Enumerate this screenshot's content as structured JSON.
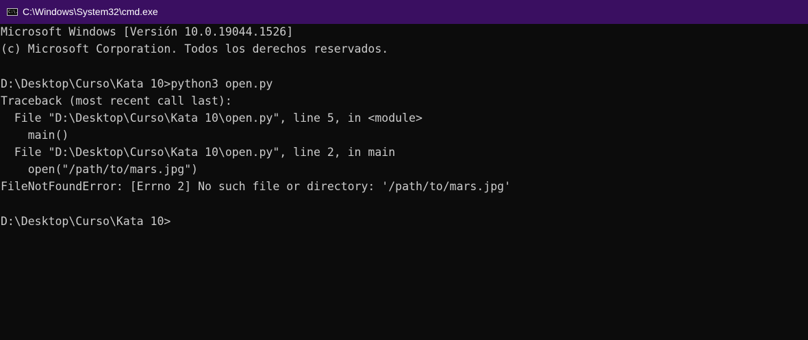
{
  "window": {
    "title": "C:\\Windows\\System32\\cmd.exe",
    "icon_label": "C:\\."
  },
  "console": {
    "lines": [
      "Microsoft Windows [Versión 10.0.19044.1526]",
      "(c) Microsoft Corporation. Todos los derechos reservados.",
      "",
      "D:\\Desktop\\Curso\\Kata 10>python3 open.py",
      "Traceback (most recent call last):",
      "  File \"D:\\Desktop\\Curso\\Kata 10\\open.py\", line 5, in <module>",
      "    main()",
      "  File \"D:\\Desktop\\Curso\\Kata 10\\open.py\", line 2, in main",
      "    open(\"/path/to/mars.jpg\")",
      "FileNotFoundError: [Errno 2] No such file or directory: '/path/to/mars.jpg'",
      "",
      "D:\\Desktop\\Curso\\Kata 10>"
    ]
  },
  "colors": {
    "titlebar": "#3a0f61",
    "background": "#0c0c0c",
    "text": "#cccccc"
  }
}
